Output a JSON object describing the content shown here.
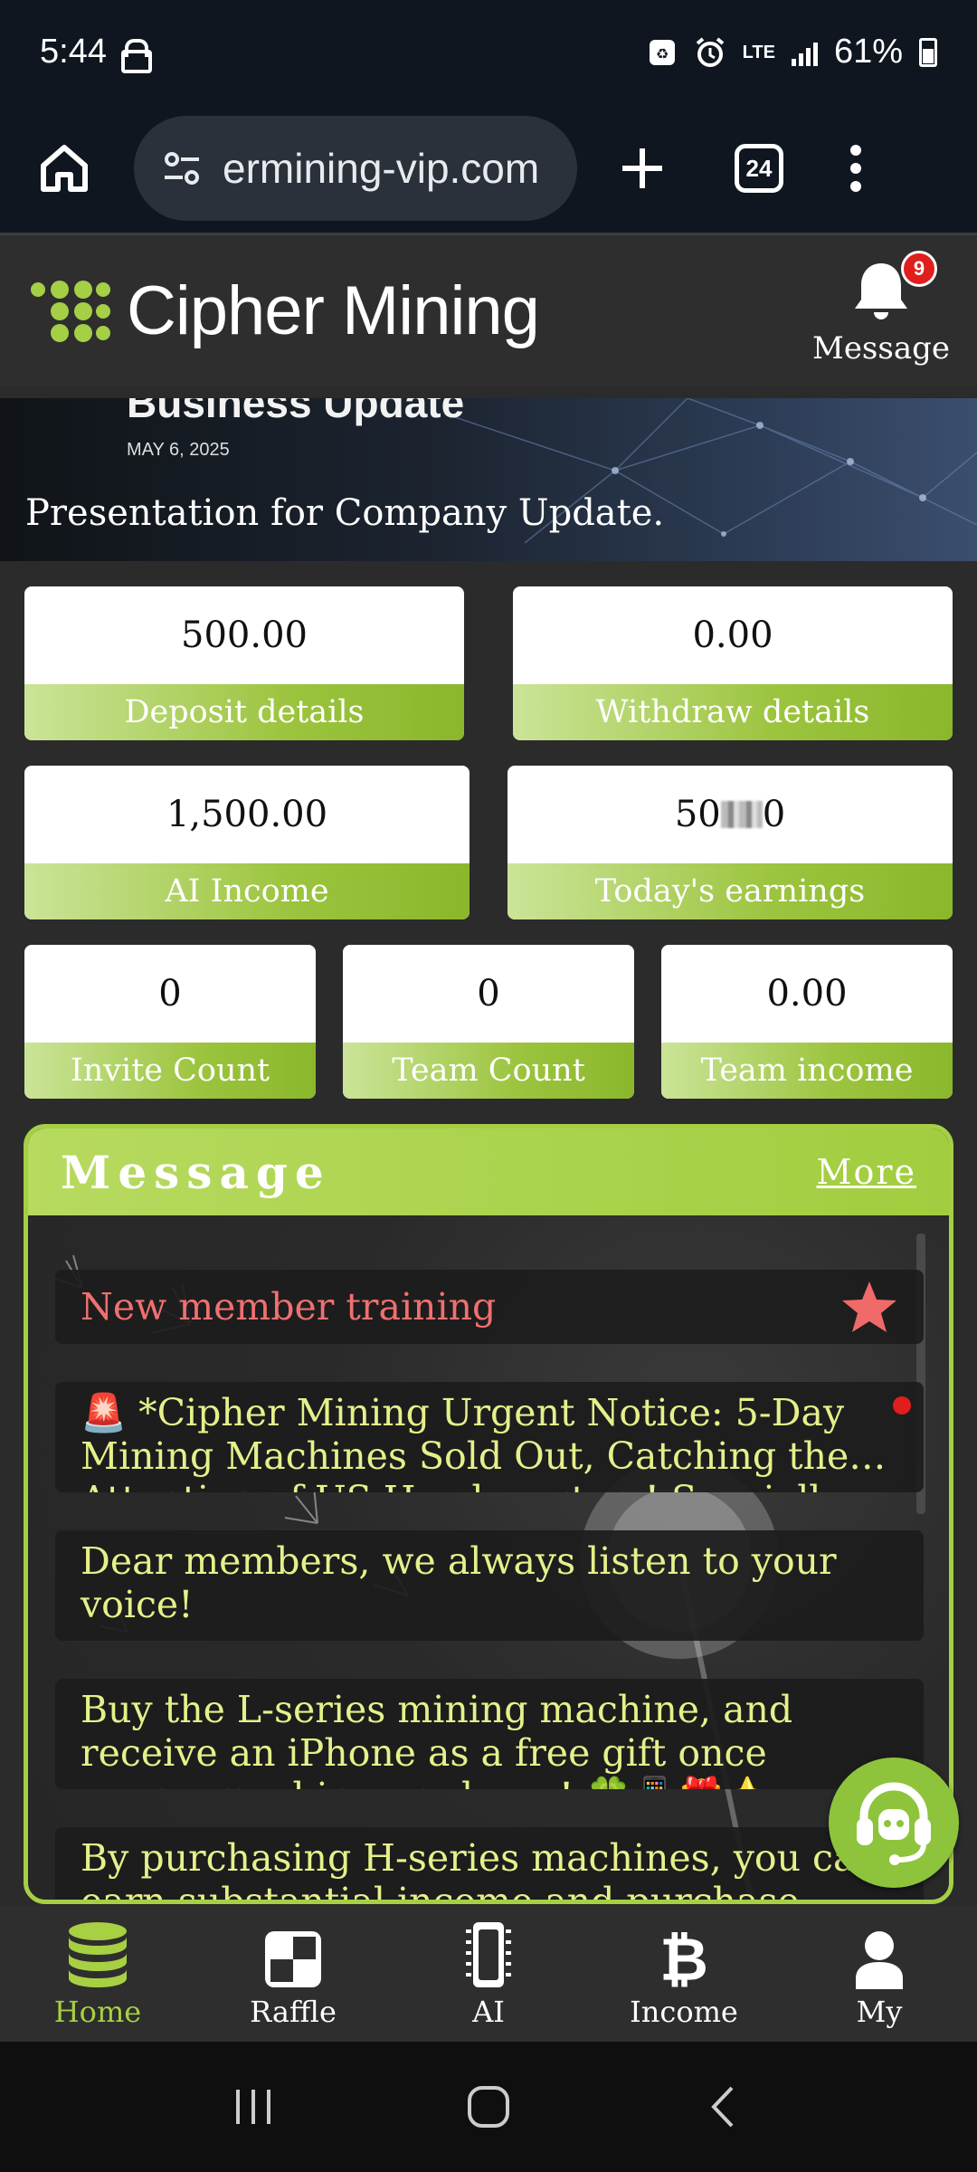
{
  "status": {
    "time": "5:44",
    "network": "LTE",
    "battery": "61%"
  },
  "browser": {
    "url": "ermining-vip.com",
    "tab_count": "24"
  },
  "header": {
    "brand": "Cipher Mining",
    "message_label": "Message",
    "message_badge": "9"
  },
  "banner": {
    "title": "Business Update",
    "date": "MAY 6, 2025",
    "caption": "Presentation for Company Update."
  },
  "stats": {
    "deposit": {
      "value": "500.00",
      "label": "Deposit details"
    },
    "withdraw": {
      "value": "0.00",
      "label": "Withdraw details"
    },
    "ai_income": {
      "value": "1,500.00",
      "label": "AI Income"
    },
    "today": {
      "value_prefix": "50",
      "value_suffix": "0",
      "label": "Today's earnings"
    },
    "invite": {
      "value": "0",
      "label": "Invite Count"
    },
    "team_count": {
      "value": "0",
      "label": "Team Count"
    },
    "team_income": {
      "value": "0.00",
      "label": "Team income"
    }
  },
  "messages": {
    "title": "Message",
    "more": "More",
    "items": [
      {
        "text": "New member training"
      },
      {
        "text": "🚨 *Cipher Mining Urgent Notice: 5-Day Mining Machines Sold Out, Catching the… Attention of US Headquarters! Specially"
      },
      {
        "text": "Dear members, we always listen to your voice!"
      },
      {
        "text": "Buy the L-series mining machine, and receive an iPhone as a free gift once your… machine produces! 🍀📱🎁⭐"
      },
      {
        "text": "By purchasing H-series machines, you can earn substantial income and purchase"
      }
    ]
  },
  "nav": {
    "home": "Home",
    "raffle": "Raffle",
    "ai": "AI",
    "income": "Income",
    "my": "My"
  },
  "colors": {
    "accent": "#a5cf45",
    "header_bg": "#2e2e2e",
    "badge": "#e01e1e"
  }
}
